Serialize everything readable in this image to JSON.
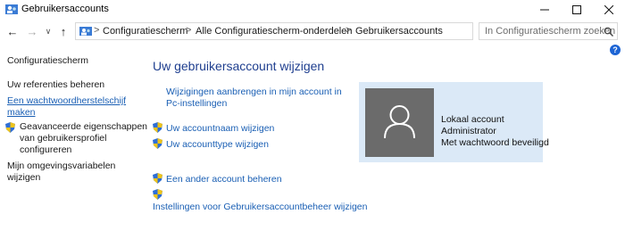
{
  "window": {
    "title": "Gebruikersaccounts"
  },
  "toolbar": {
    "back_label": "←",
    "forward_label": "→",
    "recent_label": "∨",
    "up_label": "↑"
  },
  "addressbar": {
    "crumbs": [
      "Configuratiescherm",
      "Alle Configuratiescherm-onderdelen",
      "Gebruikersaccounts"
    ],
    "separator": ">"
  },
  "search": {
    "placeholder": "In Configuratiescherm zoeken"
  },
  "sidebar": {
    "home": "Configuratiescherm",
    "credentials": "Uw referenties beheren",
    "reset_disk": [
      "Een wachtwoordherstelschijf",
      "maken"
    ],
    "advanced": [
      "Geavanceerde eigenschappen",
      "van gebruikersprofiel",
      "configureren"
    ],
    "env": [
      "Mijn omgevingsvariabelen",
      "wijzigen"
    ]
  },
  "main": {
    "heading": "Uw gebruikersaccount wijzigen",
    "pc_settings": [
      "Wijzigingen aanbrengen in mijn account in",
      "Pc-instellingen"
    ],
    "change_name": "Uw accountnaam wijzigen",
    "change_type": "Uw accounttype wijzigen",
    "manage_other": "Een ander account beheren",
    "uac_settings": "Instellingen voor Gebruikersaccountbeheer wijzigen"
  },
  "account": {
    "type": "Lokaal account",
    "role": "Administrator",
    "password": "Met wachtwoord beveiligd"
  },
  "colors": {
    "link": "#1a5fb4",
    "heading": "#1f3f8f",
    "card_bg": "#dbe9f7",
    "avatar_bg": "#6b6b6b"
  }
}
